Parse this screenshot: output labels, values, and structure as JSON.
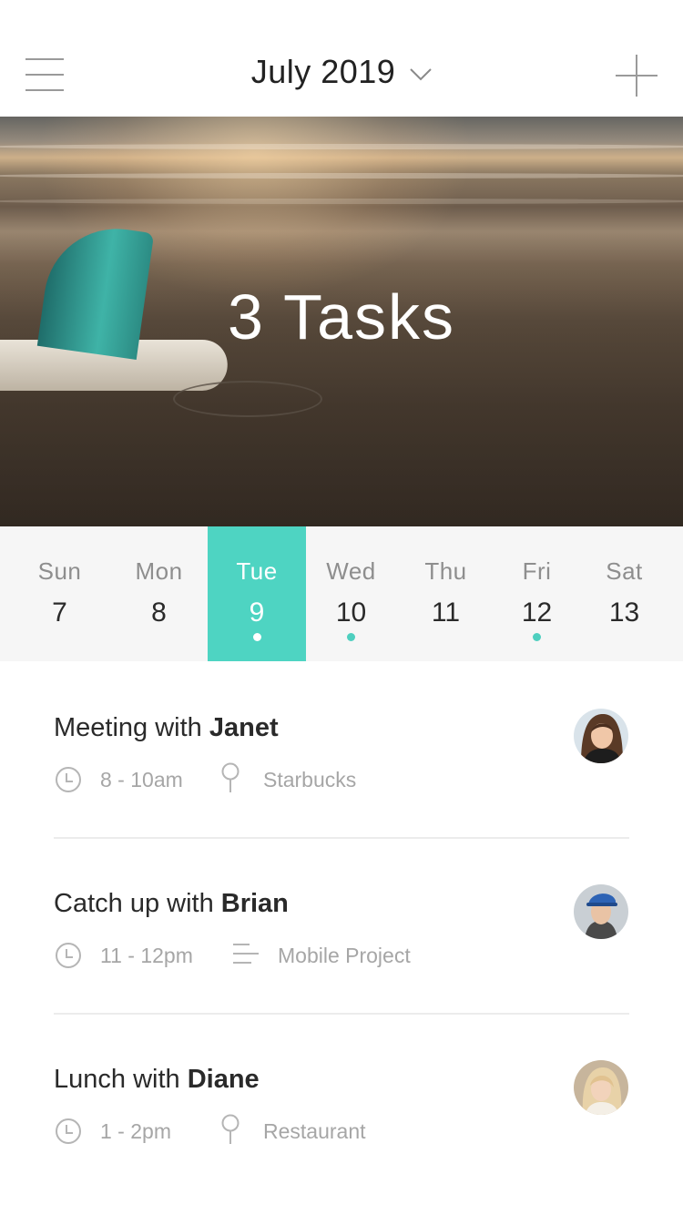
{
  "header": {
    "month_label": "July 2019",
    "menu_icon": "hamburger-menu-icon",
    "dropdown_icon": "chevron-down-icon",
    "add_icon": "plus-icon"
  },
  "hero": {
    "title": "3 Tasks",
    "image": "beach-surfboard-photo"
  },
  "week": {
    "days": [
      {
        "name": "Sun",
        "date": "7",
        "has_event": false,
        "selected": false
      },
      {
        "name": "Mon",
        "date": "8",
        "has_event": false,
        "selected": false
      },
      {
        "name": "Tue",
        "date": "9",
        "has_event": true,
        "selected": true
      },
      {
        "name": "Wed",
        "date": "10",
        "has_event": true,
        "selected": false
      },
      {
        "name": "Thu",
        "date": "11",
        "has_event": false,
        "selected": false
      },
      {
        "name": "Fri",
        "date": "12",
        "has_event": true,
        "selected": false
      },
      {
        "name": "Sat",
        "date": "13",
        "has_event": false,
        "selected": false
      }
    ]
  },
  "tasks": [
    {
      "title_prefix": "Meeting with ",
      "title_name": "Janet",
      "time": "8 - 10am",
      "detail": "Starbucks",
      "detail_icon": "location-pin-icon",
      "avatar": "janet-avatar"
    },
    {
      "title_prefix": "Catch up with ",
      "title_name": "Brian",
      "time": "11 - 12pm",
      "detail": "Mobile Project",
      "detail_icon": "notes-lines-icon",
      "avatar": "brian-avatar"
    },
    {
      "title_prefix": "Lunch with ",
      "title_name": "Diane",
      "time": "1 - 2pm",
      "detail": "Restaurant",
      "detail_icon": "location-pin-icon",
      "avatar": "diane-avatar"
    }
  ],
  "colors": {
    "accent": "#4ed4c2",
    "dot": "#4ecfbf",
    "muted_text": "#a6a6a6",
    "week_bg": "#f6f6f6"
  }
}
